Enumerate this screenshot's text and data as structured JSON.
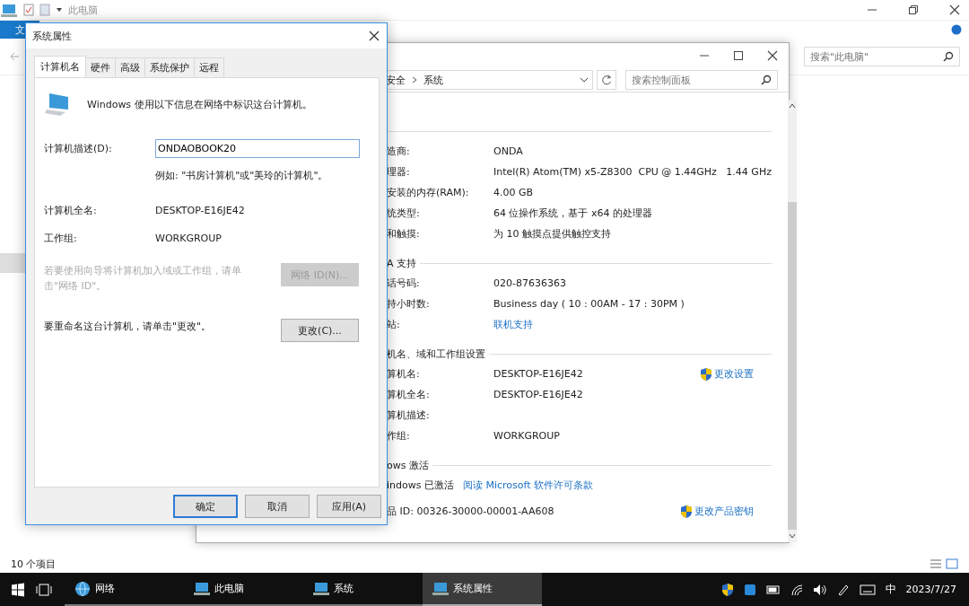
{
  "explorer": {
    "title": "此电脑",
    "ribbon_tab": "文",
    "search": {
      "placeholder": "搜索\"此电脑\""
    },
    "status_bar": "10 个项目"
  },
  "system_window": {
    "breadcrumb": [
      "安全",
      "系统"
    ],
    "search": {
      "placeholder": "搜索控制面板"
    },
    "sections": [
      {
        "rows": [
          {
            "kind": "pair",
            "label": "造商:",
            "value": "ONDA"
          },
          {
            "kind": "pair",
            "label": "理器:",
            "value": "Intel(R) Atom(TM) x5-Z8300  CPU @ 1.44GHz   1.44 GHz"
          },
          {
            "kind": "pair",
            "label": "安装的内存(RAM):",
            "value": "4.00 GB"
          },
          {
            "kind": "pair",
            "label": "统类型:",
            "value": "64 位操作系统，基于 x64 的处理器"
          },
          {
            "kind": "pair",
            "label": "和触摸:",
            "value": "为 10 触摸点提供触控支持"
          }
        ]
      },
      {
        "heading": "A 支持",
        "rows": [
          {
            "kind": "pair",
            "label": "话号码:",
            "value": "020-87636363"
          },
          {
            "kind": "pair",
            "label": "持小时数:",
            "value": "Business day ( 10 : 00AM - 17 : 30PM )"
          },
          {
            "kind": "pair",
            "label": "站:",
            "value": "联机支持",
            "link": true
          }
        ]
      },
      {
        "heading": "机名、域和工作组设置",
        "rows": [
          {
            "kind": "pair",
            "label": "算机名:",
            "value": "DESKTOP-E16JE42",
            "action": "更改设置"
          },
          {
            "kind": "pair",
            "label": "算机全名:",
            "value": "DESKTOP-E16JE42"
          },
          {
            "kind": "pair",
            "label": "算机描述:"
          },
          {
            "kind": "pair",
            "label": "作组:",
            "value": "WORKGROUP"
          }
        ]
      },
      {
        "heading": "ows 激活",
        "rows": [
          {
            "kind": "inline",
            "label": "indows 已激活",
            "value": "阅读 Microsoft 软件许可条款",
            "link": true
          },
          {
            "kind": "inline",
            "label": "品 ID: 00326-30000-00001-AA608",
            "action": "更改产品密钥"
          }
        ]
      }
    ]
  },
  "dialog": {
    "title": "系统属性",
    "tabs": [
      {
        "label": "计算机名",
        "selected": true
      },
      {
        "label": "硬件",
        "selected": false
      },
      {
        "label": "高级",
        "selected": false
      },
      {
        "label": "系统保护",
        "selected": false
      },
      {
        "label": "远程",
        "selected": false
      }
    ],
    "intro": "Windows 使用以下信息在网络中标识这台计算机。",
    "description_field": {
      "label": "计算机描述(D):",
      "value": "ONDAOBOOK20"
    },
    "hint": "例如: \"书房计算机\"或\"美玲的计算机\"。",
    "full_name": {
      "label": "计算机全名:",
      "value": "DESKTOP-E16JE42"
    },
    "workgroup": {
      "label": "工作组:",
      "value": "WORKGROUP"
    },
    "network_id": {
      "text": "若要使用向导将计算机加入域或工作组，请单击\"网络 ID\"。",
      "button": "网络 ID(N)...",
      "disabled": true
    },
    "rename": {
      "text": "要重命名这台计算机，请单击\"更改\"。",
      "button": "更改(C)...",
      "disabled": false
    },
    "buttons": [
      {
        "label": "确定",
        "default": true
      },
      {
        "label": "取消",
        "default": false
      },
      {
        "label": "应用(A)",
        "default": false
      }
    ]
  },
  "taskbar": {
    "items": [
      {
        "label": "网络",
        "selected": false
      },
      {
        "label": "此电脑",
        "selected": false
      },
      {
        "label": "系统",
        "selected": false
      },
      {
        "label": "系统属性",
        "selected": true
      }
    ],
    "ime": "中",
    "date": "2023/7/27"
  }
}
